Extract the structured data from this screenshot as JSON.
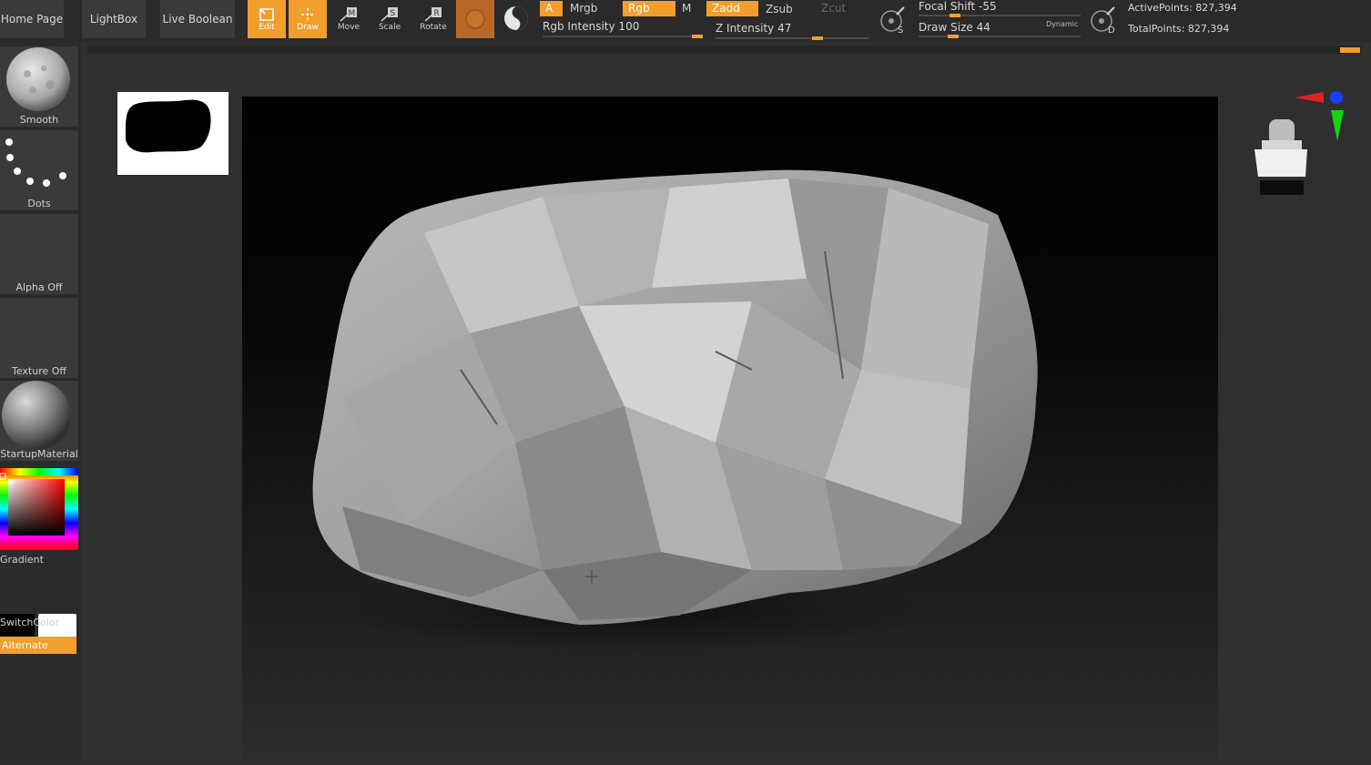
{
  "nav": {
    "home": "Home Page",
    "lightbox": "LightBox",
    "live_boolean": "Live Boolean"
  },
  "tools": {
    "edit": "Edit",
    "draw": "Draw",
    "move": "Move",
    "scale": "Scale",
    "rotate": "Rotate"
  },
  "modes": {
    "a": "A",
    "mrgb": "Mrgb",
    "rgb": "Rgb",
    "m": "M",
    "zadd": "Zadd",
    "zsub": "Zsub",
    "zcut": "Zcut"
  },
  "sliders": {
    "rgb_intensity": {
      "label": "Rgb Intensity 100",
      "value": 100
    },
    "z_intensity": {
      "label": "Z Intensity 47",
      "value": 47
    },
    "focal_shift": {
      "label": "Focal Shift -55",
      "value": -55
    },
    "draw_size": {
      "label": "Draw Size 44",
      "value": 44
    },
    "dynamic": "Dynamic"
  },
  "stats": {
    "active": "ActivePoints: 827,394",
    "total": "TotalPoints: 827,394"
  },
  "shelf": {
    "brush": "Smooth",
    "stroke": "Dots",
    "alpha": "Alpha Off",
    "texture": "Texture Off",
    "material": "StartupMaterial",
    "gradient": "Gradient",
    "switch_color": "SwitchColor",
    "alternate": "Alternate"
  },
  "icons": {
    "edit": "edit-icon",
    "draw": "draw-icon",
    "move": "move-icon",
    "scale": "scale-icon",
    "rotate": "rotate-icon",
    "sphere": "sphere-icon",
    "s_dial": "s-dial-icon",
    "d_dial": "d-dial-icon",
    "gizmo": "axis-gizmo-icon",
    "figure": "navigation-figure-icon"
  },
  "colors": {
    "accent": "#f29e2c",
    "panel": "#2b2b2b",
    "primary_color": "#000000",
    "secondary_color": "#ffffff"
  }
}
